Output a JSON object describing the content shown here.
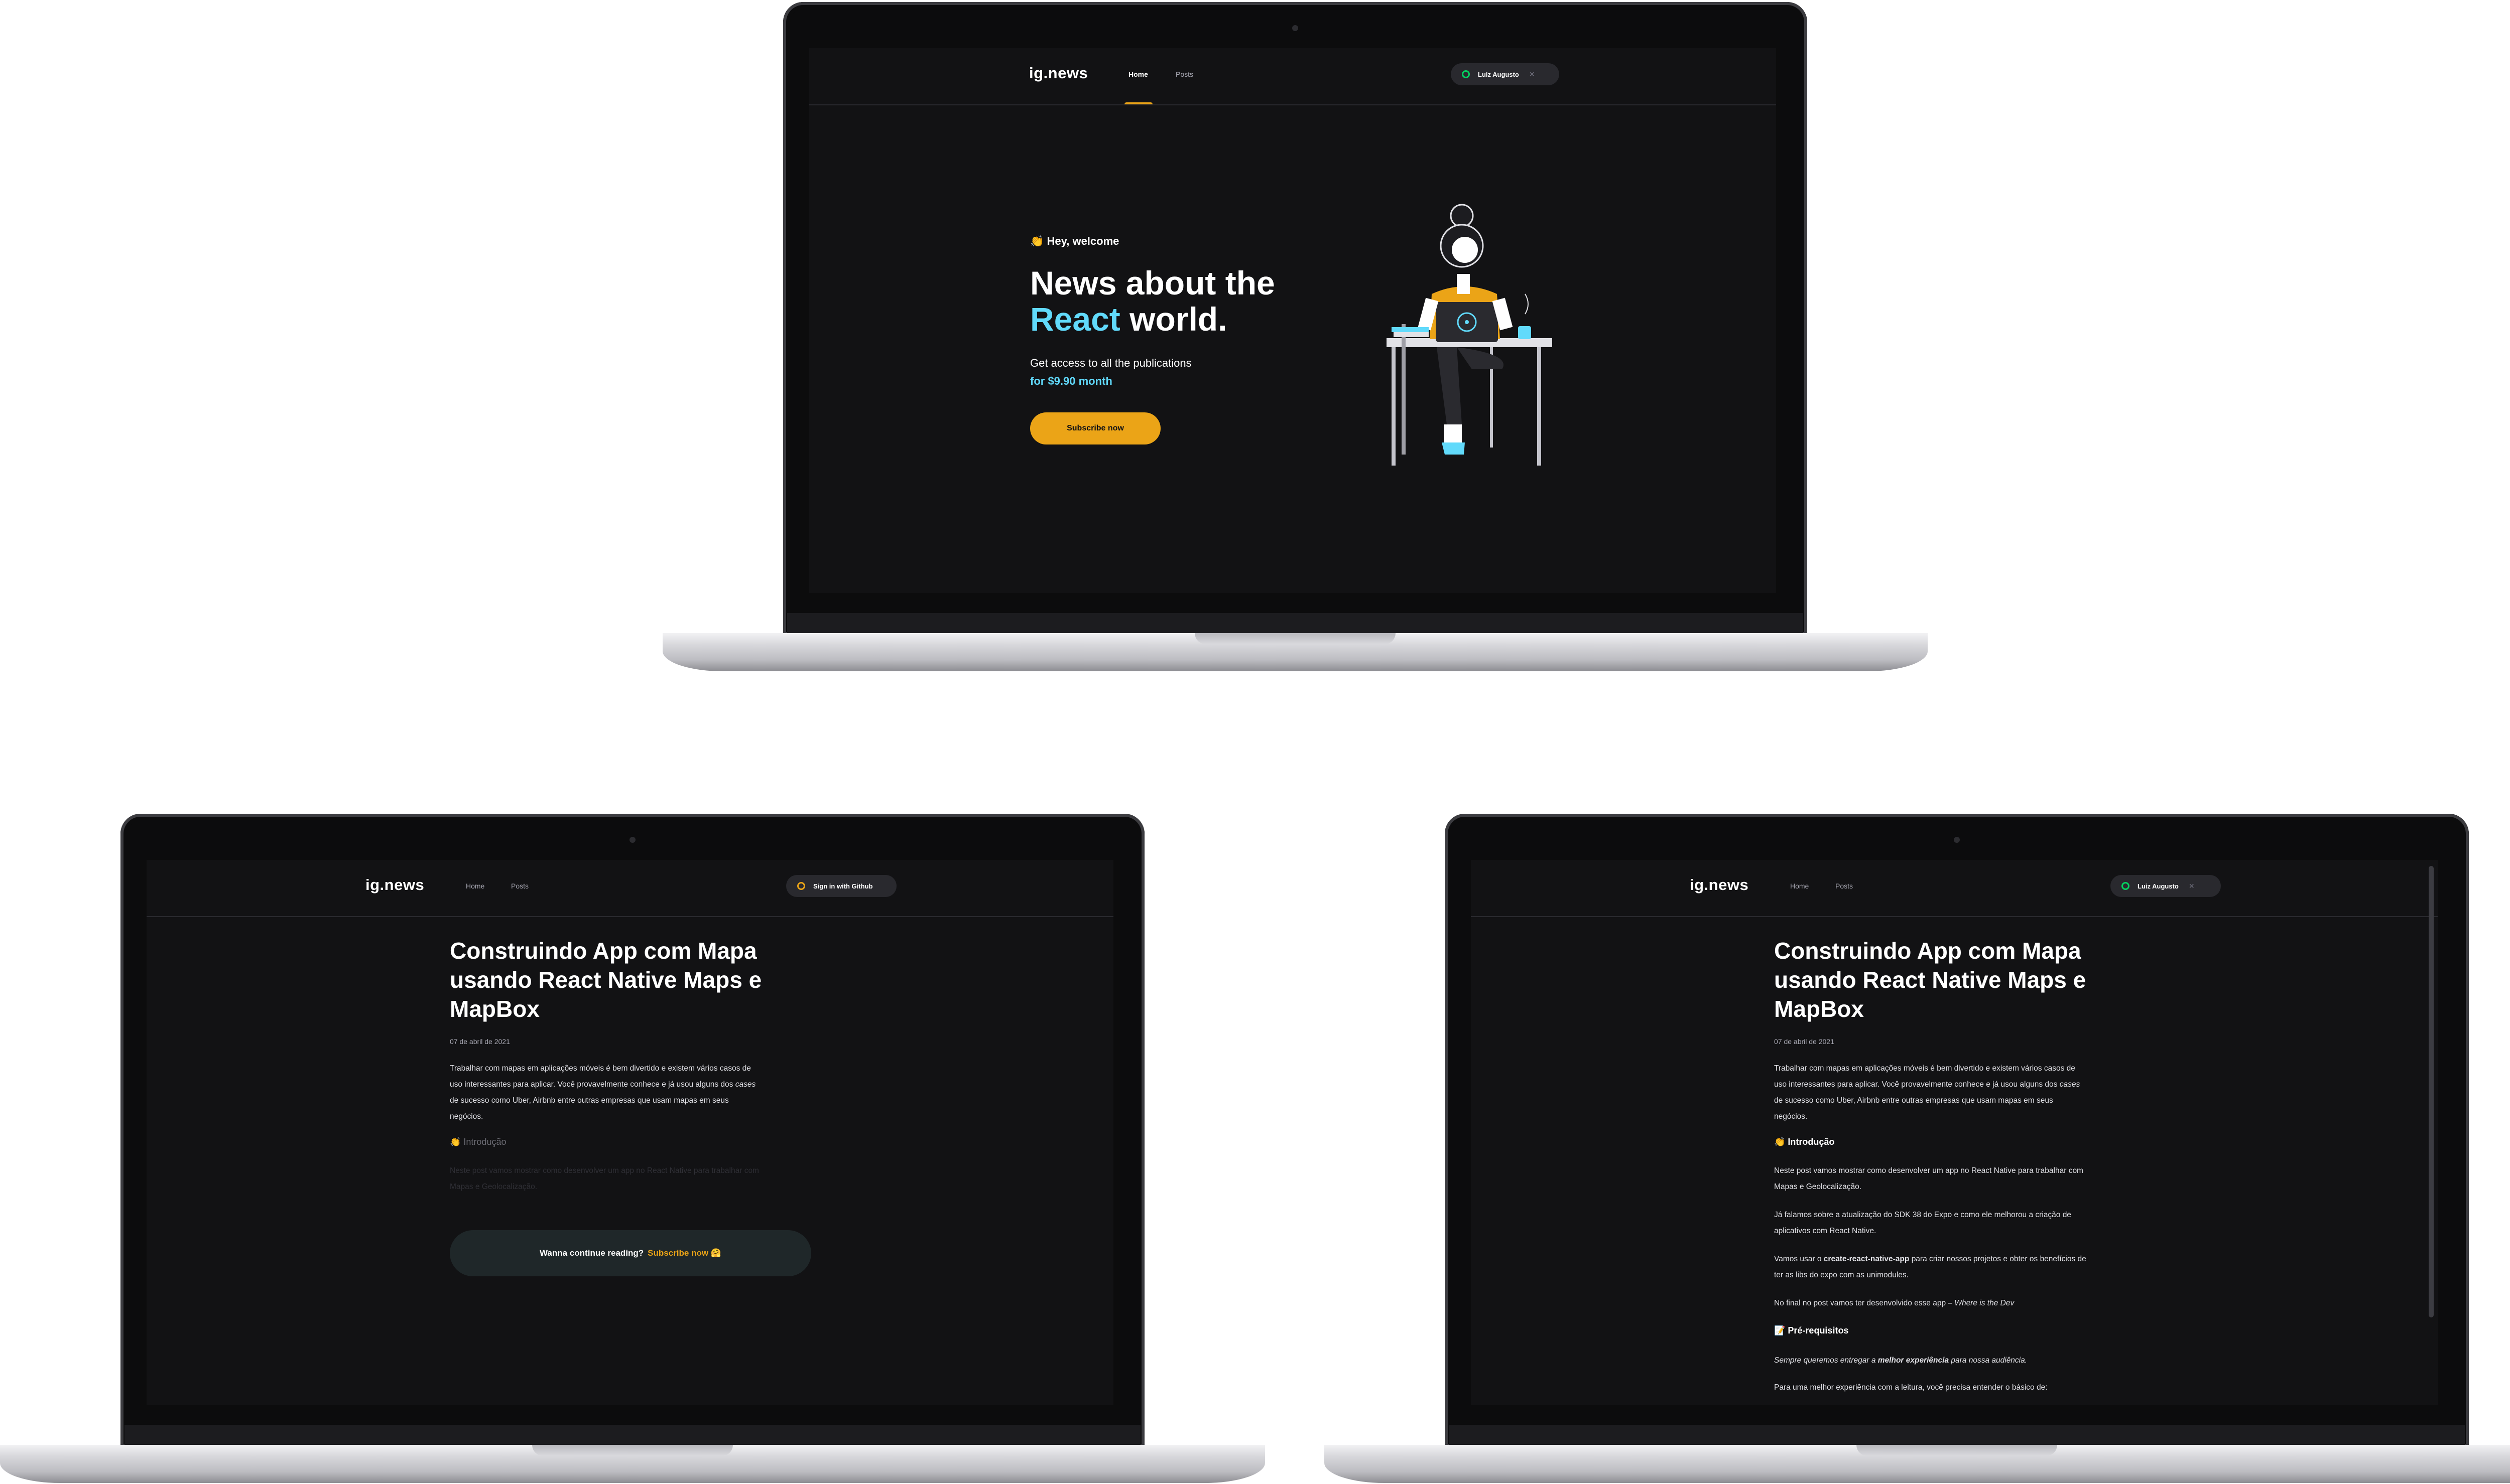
{
  "brand": {
    "logo": "ig.news",
    "accent": "#eba417",
    "react_color": "#61dafb",
    "bg": "#121214"
  },
  "home": {
    "nav": {
      "home": "Home",
      "posts": "Posts"
    },
    "user": {
      "name": "Luiz Augusto",
      "close": "✕",
      "status_color": "#04d361"
    },
    "welcome": "👏 Hey, welcome",
    "title_line1": "News about the",
    "title_react": "React",
    "title_rest": " world.",
    "subtitle": "Get access to all the publications",
    "price": "for $9.90 month",
    "cta": "Subscribe now",
    "illustration": "avatar-illustration"
  },
  "preview": {
    "nav": {
      "home": "Home",
      "posts": "Posts"
    },
    "signin": "Sign in with Github",
    "signin_color": "#eba417",
    "title": "Construindo App com Mapa usando React Native Maps e MapBox",
    "date": "07 de abril de 2021",
    "p1a": "Trabalhar com mapas em aplicações móveis é bem divertido e existem vários casos de",
    "p1b": "uso interessantes para aplicar. Você provavelmente conhece e já usou alguns dos",
    "p1c": "cases",
    "p1d": "de sucesso como Uber, Airbnb entre outras empresas que usam mapas em seus",
    "p1e": "negócios.",
    "h_intro": "👏 Introdução",
    "faded1": "Neste post vamos mostrar como desenvolver um app no React Native para trabalhar com",
    "faded2": "Mapas e Geolocalização.",
    "continue": "Wanna continue reading?",
    "continue_link": "Subscribe now 🤗"
  },
  "full": {
    "nav": {
      "home": "Home",
      "posts": "Posts"
    },
    "user": {
      "name": "Luiz Augusto",
      "close": "✕"
    },
    "title": "Construindo App com Mapa usando React Native Maps e MapBox",
    "date": "07 de abril de 2021",
    "p1a": "Trabalhar com mapas em aplicações móveis é bem divertido e existem vários casos de",
    "p1b": "uso interessantes para aplicar. Você provavelmente conhece e já usou alguns dos",
    "p1c": "cases",
    "p1d": "de sucesso como Uber, Airbnb entre outras empresas que usam mapas em seus",
    "p1e": "negócios.",
    "h_intro": "👏 Introdução",
    "p2a": "Neste post vamos mostrar como desenvolver um app no React Native para trabalhar com",
    "p2b": "Mapas e Geolocalização.",
    "p3a": "Já falamos sobre a atualização do SDK 38 do Expo e como ele melhorou a criação de",
    "p3b": "aplicativos com React Native.",
    "p4a": "Vamos usar o",
    "p4code": "create-react-native-app",
    "p4b": "para criar nossos projetos e obter os benefícios de",
    "p4c": "ter as libs do expo com as unimodules.",
    "p5a": "No final no post vamos ter desenvolvido esse app –",
    "p5em": "Where is the Dev",
    "h_pre": "📝 Pré-requisitos",
    "p6a": "Sempre queremos entregar a",
    "p6b": "melhor experiência",
    "p6c": "para nossa audiência.",
    "p7": "Para uma melhor experiência com a leitura, você precisa entender o básico de:"
  }
}
